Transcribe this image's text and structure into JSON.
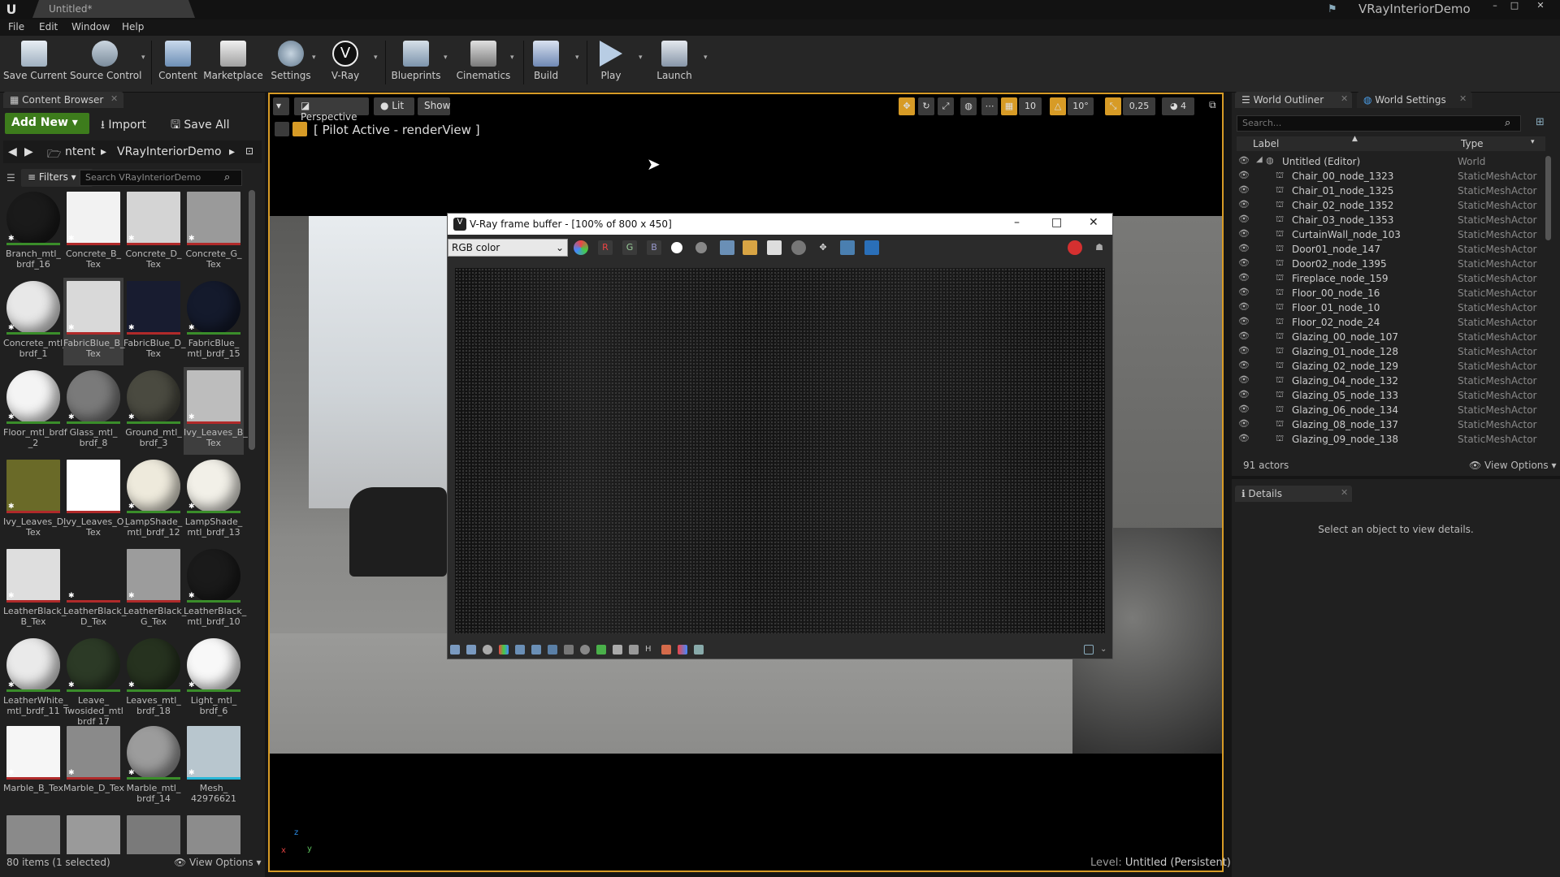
{
  "window": {
    "tab_title": "Untitled*",
    "project": "VRayInteriorDemo",
    "minimize": "–",
    "maximize": "□",
    "close": "✕"
  },
  "menu": [
    "File",
    "Edit",
    "Window",
    "Help"
  ],
  "toolbar": [
    "Save Current",
    "Source Control",
    "Content",
    "Marketplace",
    "Settings",
    "V-Ray",
    "Blueprints",
    "Cinematics",
    "Build",
    "Play",
    "Launch"
  ],
  "content_browser": {
    "tab": "Content Browser",
    "add_new": "Add New ▾",
    "import": "⭳ Import",
    "save_all": "🖫 Save All",
    "path": [
      "◀",
      "▶",
      "🗁",
      "ntent",
      "▸",
      "VRayInteriorDemo",
      "▸"
    ],
    "filters": "≡ Filters ▾",
    "search_placeholder": "Search VRayInteriorDemo",
    "assets": [
      {
        "name": "Branch_mtl_\nbrdf_16",
        "color": "#1a1a1a",
        "strip": "#3a8d2a",
        "round": true
      },
      {
        "name": "Concrete_B_\nTex",
        "color": "#f2f2f2",
        "strip": "#b02a2a",
        "round": false
      },
      {
        "name": "Concrete_D_\nTex",
        "color": "#d4d4d4",
        "strip": "#b02a2a",
        "round": false
      },
      {
        "name": "Concrete_G_\nTex",
        "color": "#9a9a9a",
        "strip": "#b02a2a",
        "round": false
      },
      {
        "name": "Concrete_mtl_\nbrdf_1",
        "color": "#e8e8e8",
        "strip": "#3a8d2a",
        "round": true
      },
      {
        "name": "FabricBlue_B_\nTex",
        "color": "#d9d9d9",
        "strip": "#b02a2a",
        "round": false,
        "selected": true
      },
      {
        "name": "FabricBlue_D_\nTex",
        "color": "#181c30",
        "strip": "#b02a2a",
        "round": false
      },
      {
        "name": "FabricBlue_\nmtl_brdf_15",
        "color": "#141a2c",
        "strip": "#3a8d2a",
        "round": true
      },
      {
        "name": "Floor_mtl_brdf\n_2",
        "color": "#f4f4f4",
        "strip": "#3a8d2a",
        "round": true
      },
      {
        "name": "Glass_mtl_\nbrdf_8",
        "color": "#7a7a7a",
        "strip": "#3a8d2a",
        "round": true
      },
      {
        "name": "Ground_mtl_\nbrdf_3",
        "color": "#4a4a40",
        "strip": "#3a8d2a",
        "round": true
      },
      {
        "name": "Ivy_Leaves_B_\nTex",
        "color": "#bdbdbd",
        "strip": "#b02a2a",
        "round": false,
        "selected": true
      },
      {
        "name": "Ivy_Leaves_D_\nTex",
        "color": "#6a6a28",
        "strip": "#b02a2a",
        "round": false
      },
      {
        "name": "Ivy_Leaves_O_\nTex",
        "color": "#ffffff",
        "strip": "#b02a2a",
        "round": false
      },
      {
        "name": "LampShade_\nmtl_brdf_12",
        "color": "#eeeadc",
        "strip": "#3a8d2a",
        "round": true
      },
      {
        "name": "LampShade_\nmtl_brdf_13",
        "color": "#f2f0e8",
        "strip": "#3a8d2a",
        "round": true
      },
      {
        "name": "LeatherBlack_\nB_Tex",
        "color": "#dedede",
        "strip": "#b02a2a",
        "round": false
      },
      {
        "name": "LeatherBlack_\nD_Tex",
        "color": "#202020",
        "strip": "#b02a2a",
        "round": false
      },
      {
        "name": "LeatherBlack_\nG_Tex",
        "color": "#9c9c9c",
        "strip": "#b02a2a",
        "round": false
      },
      {
        "name": "LeatherBlack_\nmtl_brdf_10",
        "color": "#1a1a1a",
        "strip": "#3a8d2a",
        "round": true
      },
      {
        "name": "LeatherWhite_\nmtl_brdf_11",
        "color": "#eaeaea",
        "strip": "#3a8d2a",
        "round": true
      },
      {
        "name": "Leave_\nTwosided_mtl\nbrdf 17",
        "color": "#2c3a26",
        "strip": "#3a8d2a",
        "round": true
      },
      {
        "name": "Leaves_mtl_\nbrdf_18",
        "color": "#26321f",
        "strip": "#3a8d2a",
        "round": true
      },
      {
        "name": "Light_mtl_\nbrdf_6",
        "color": "#f8f8f8",
        "strip": "#3a8d2a",
        "round": true
      },
      {
        "name": "Marble_B_Tex",
        "color": "#f6f6f6",
        "strip": "#b02a2a",
        "round": false
      },
      {
        "name": "Marble_D_Tex",
        "color": "#8a8a8a",
        "strip": "#b02a2a",
        "round": false
      },
      {
        "name": "Marble_mtl_\nbrdf_14",
        "color": "#9c9c9c",
        "strip": "#3a8d2a",
        "round": true
      },
      {
        "name": "Mesh_\n42976621",
        "color": "#b8c6ce",
        "strip": "#29b6d6",
        "round": false
      },
      {
        "name": "",
        "color": "#8a8a8a",
        "strip": "#29b6d6",
        "round": false
      },
      {
        "name": "",
        "color": "#9a9a9a",
        "strip": "#29b6d6",
        "round": false
      },
      {
        "name": "",
        "color": "#7a7a7a",
        "strip": "#29b6d6",
        "round": false
      },
      {
        "name": "",
        "color": "#8c8c8c",
        "strip": "#29b6d6",
        "round": false
      }
    ],
    "status": "80 items (1 selected)",
    "view_options": "👁 View Options ▾"
  },
  "viewport": {
    "perspective": "Perspective",
    "lit": "Lit",
    "show": "Show",
    "pilot": "[ Pilot Active - renderView ]",
    "right_controls": [
      "10",
      "10°",
      "0,25",
      "4"
    ],
    "level_prefix": "Level:",
    "level": "Untitled (Persistent)",
    "axis_z": "z",
    "axis_y": "y",
    "axis_x": "x"
  },
  "frame_buffer": {
    "title": "V-Ray frame buffer - [100% of 800 x 450]",
    "channel": "RGB color",
    "r": "R",
    "g": "G",
    "b": "B"
  },
  "outliner": {
    "tab": "World Outliner",
    "tab2": "World Settings",
    "search_placeholder": "Search...",
    "col_label": "Label",
    "col_type": "Type",
    "root": {
      "label": "Untitled (Editor)",
      "type": "World"
    },
    "rows": [
      [
        "Chair_00_node_1323",
        "StaticMeshActor"
      ],
      [
        "Chair_01_node_1325",
        "StaticMeshActor"
      ],
      [
        "Chair_02_node_1352",
        "StaticMeshActor"
      ],
      [
        "Chair_03_node_1353",
        "StaticMeshActor"
      ],
      [
        "CurtainWall_node_103",
        "StaticMeshActor"
      ],
      [
        "Door01_node_147",
        "StaticMeshActor"
      ],
      [
        "Door02_node_1395",
        "StaticMeshActor"
      ],
      [
        "Fireplace_node_159",
        "StaticMeshActor"
      ],
      [
        "Floor_00_node_16",
        "StaticMeshActor"
      ],
      [
        "Floor_01_node_10",
        "StaticMeshActor"
      ],
      [
        "Floor_02_node_24",
        "StaticMeshActor"
      ],
      [
        "Glazing_00_node_107",
        "StaticMeshActor"
      ],
      [
        "Glazing_01_node_128",
        "StaticMeshActor"
      ],
      [
        "Glazing_02_node_129",
        "StaticMeshActor"
      ],
      [
        "Glazing_04_node_132",
        "StaticMeshActor"
      ],
      [
        "Glazing_05_node_133",
        "StaticMeshActor"
      ],
      [
        "Glazing_06_node_134",
        "StaticMeshActor"
      ],
      [
        "Glazing_08_node_137",
        "StaticMeshActor"
      ],
      [
        "Glazing_09_node_138",
        "StaticMeshActor"
      ]
    ],
    "status": "91 actors",
    "view_options": "👁 View Options ▾"
  },
  "details": {
    "tab": "Details",
    "hint": "Select an object to view details."
  }
}
